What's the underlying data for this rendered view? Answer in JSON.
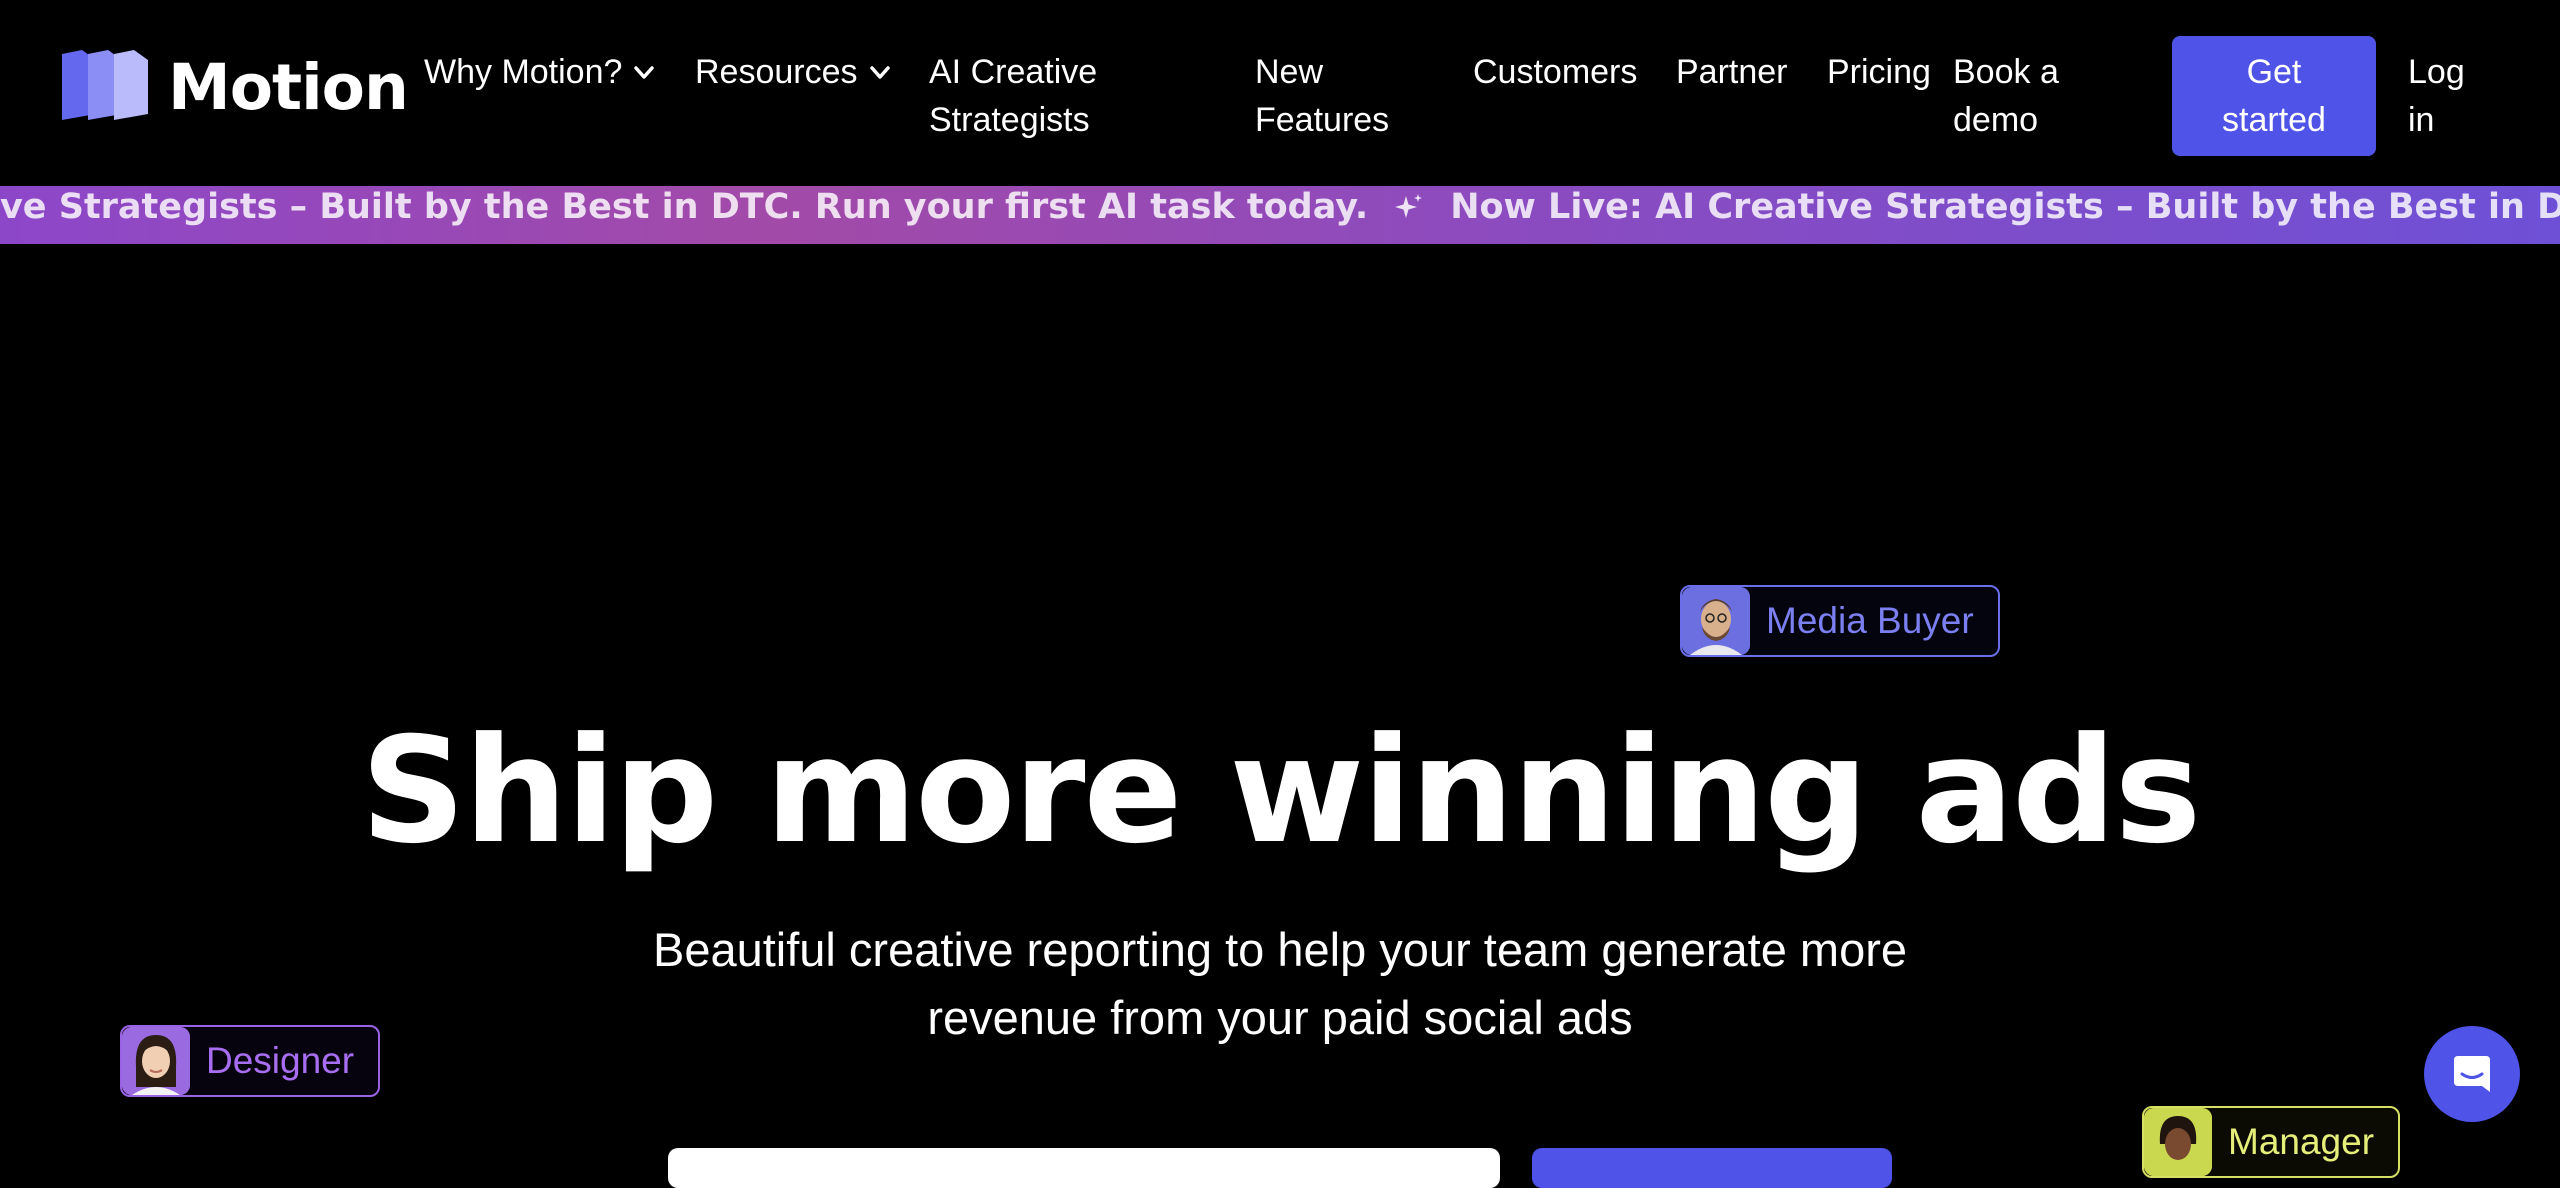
{
  "brand": {
    "name": "Motion"
  },
  "nav": {
    "items": [
      {
        "label": "Why Motion?",
        "dropdown": true
      },
      {
        "label": "Resources",
        "dropdown": true
      },
      {
        "label_line1": "AI Creative",
        "label_line2": "Strategists"
      },
      {
        "label_line1": "New",
        "label_line2": "Features"
      },
      {
        "label": "Customers"
      },
      {
        "label": "Partner"
      },
      {
        "label": "Pricing"
      },
      {
        "label_line1": "Book a",
        "label_line2": "demo"
      }
    ],
    "get_started": {
      "line1": "Get",
      "line2": "started"
    },
    "login": {
      "line1": "Log",
      "line2": "in"
    }
  },
  "banner": {
    "segment_partial": "ive Strategists – Built by the Best in DTC. Run your first AI task today.",
    "segment_full": "Now Live: AI Creative Strategists – Built by the Best in DTC. Run your first AI task today."
  },
  "hero": {
    "title": "Ship more winning ads",
    "subtitle_line1": "Beautiful creative reporting to help your team generate more",
    "subtitle_line2": "revenue from your paid social ads"
  },
  "badges": {
    "media_buyer": "Media Buyer",
    "designer": "Designer",
    "manager": "Manager"
  },
  "colors": {
    "accent": "#4f53e8",
    "banner_start": "#8c47c9",
    "banner_end": "#6e50d6",
    "media_buyer": "#7b7ff0",
    "designer": "#a86ef2",
    "manager": "#e6ee7a"
  },
  "icons": {
    "dropdown": "chevron-down-icon",
    "banner_separator": "sparkle-icon",
    "chat": "chat-bubble-icon"
  }
}
